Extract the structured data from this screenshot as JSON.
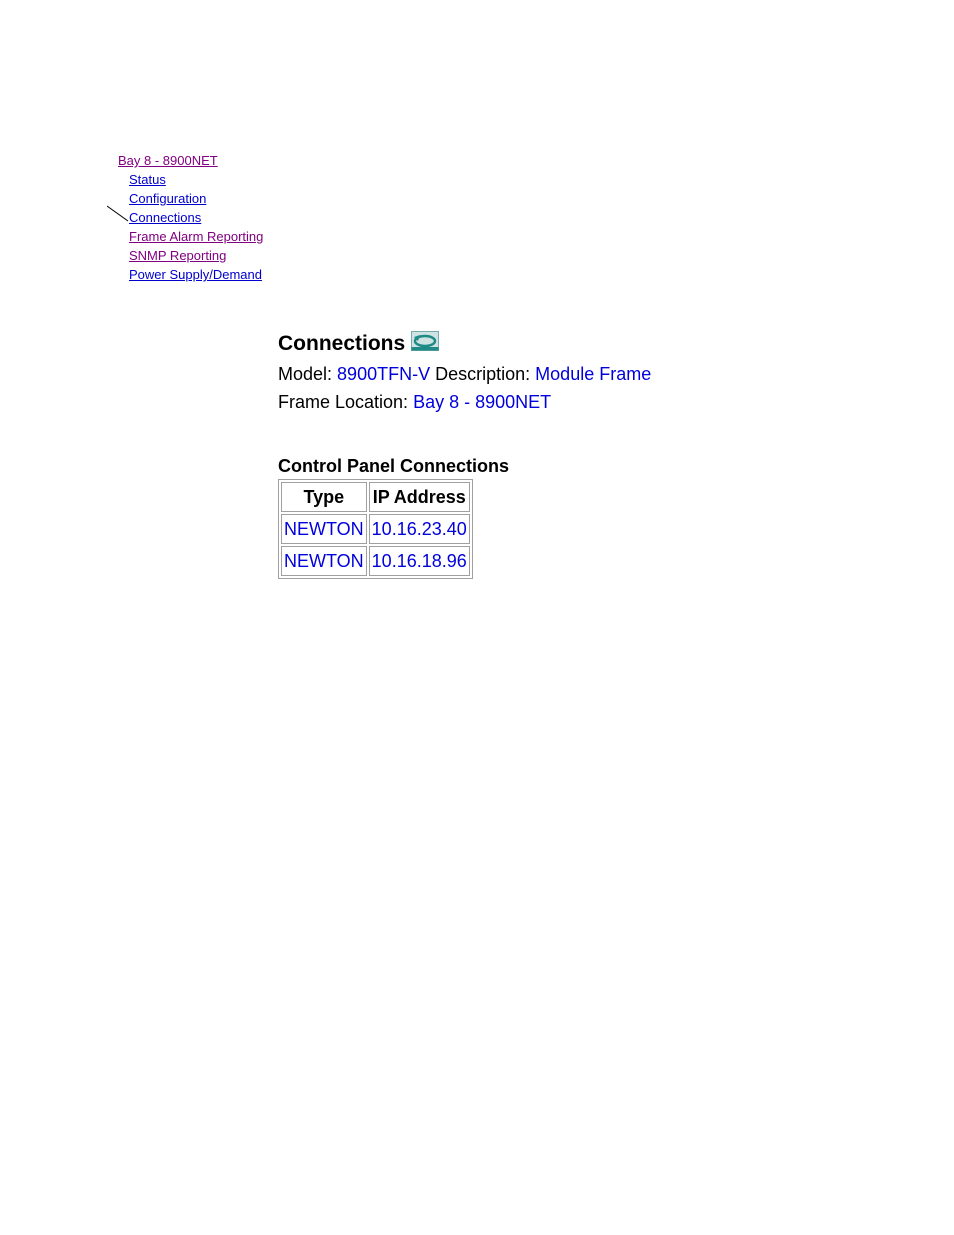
{
  "nav": {
    "root": "Bay 8 - 8900NET",
    "items": [
      {
        "label": "Status"
      },
      {
        "label": "Configuration"
      },
      {
        "label": "Connections"
      },
      {
        "label": "Frame Alarm Reporting"
      },
      {
        "label": "SNMP Reporting"
      },
      {
        "label": "Power Supply/Demand"
      }
    ]
  },
  "page": {
    "title": "Connections",
    "refresh_icon": "refresh-icon",
    "model_label": "Model:",
    "model_value": "8900TFN-V",
    "description_label": "Description:",
    "description_value": "Module Frame",
    "location_label": "Frame Location:",
    "location_value": "Bay 8 - 8900NET"
  },
  "control_panel": {
    "title": "Control Panel Connections",
    "columns": [
      "Type",
      "IP Address"
    ],
    "rows": [
      [
        "NEWTON",
        "10.16.23.40"
      ],
      [
        "NEWTON",
        "10.16.18.96"
      ]
    ]
  },
  "colors": {
    "link": "#0000cc",
    "visited_link": "#800080",
    "value_text": "#0000dd",
    "icon_teal": "#2a9d9a"
  }
}
